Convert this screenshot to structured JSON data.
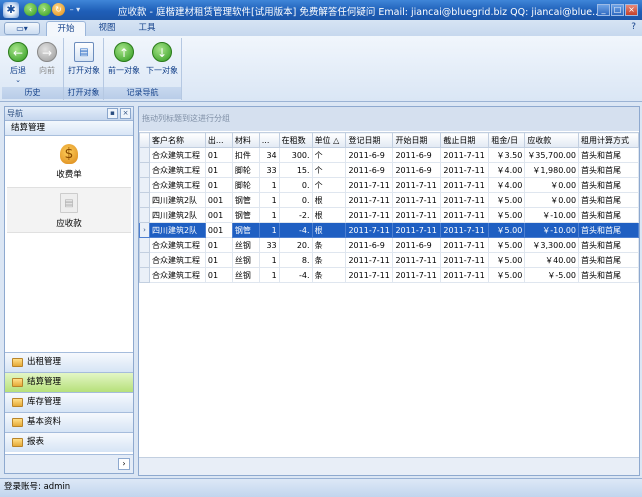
{
  "window": {
    "title": "应收款 - 庭楷建材租赁管理软件[试用版本] 免费解答任何疑问 Email: jiancai@bluegrid.biz QQ: jiancai@blue...",
    "minimize": "_",
    "maximize": "□",
    "close": "×"
  },
  "ribbon": {
    "file_button": "▭▾",
    "tabs": [
      {
        "label": "开始",
        "active": true
      },
      {
        "label": "视图",
        "active": false
      },
      {
        "label": "工具",
        "active": false
      }
    ],
    "help": "?",
    "groups": [
      {
        "label": "历史",
        "buttons": [
          {
            "label": "后退",
            "sub": "⌄",
            "icon": "back-arrow-icon"
          },
          {
            "label": "向前",
            "icon": "forward-arrow-icon",
            "disabled": true
          }
        ]
      },
      {
        "label": "打开对象",
        "buttons": [
          {
            "label": "打开对象",
            "icon": "open-object-icon"
          }
        ]
      },
      {
        "label": "记录导航",
        "buttons": [
          {
            "label": "前一对象",
            "icon": "up-arrow-icon"
          },
          {
            "label": "下一对象",
            "icon": "down-arrow-icon"
          }
        ]
      }
    ]
  },
  "nav": {
    "title": "导航",
    "pin": "▪",
    "close": "×",
    "group_title": "结算管理",
    "items": [
      {
        "label": "收费单",
        "icon": "money-bag-icon",
        "selected": true
      },
      {
        "label": "应收款",
        "icon": "receipt-icon",
        "selected": false
      }
    ],
    "bars": [
      {
        "label": "出租管理",
        "active": false
      },
      {
        "label": "结算管理",
        "active": true
      },
      {
        "label": "库存管理",
        "active": false
      },
      {
        "label": "基本资料",
        "active": false
      },
      {
        "label": "报表",
        "active": false
      }
    ],
    "expand": "›"
  },
  "grid": {
    "group_hint": "拖动列标题到这进行分组",
    "columns": [
      "客户名称",
      "出...",
      "材料",
      "...",
      "在租数",
      "单位 △",
      "登记日期",
      "开始日期",
      "截止日期",
      "租金/日",
      "应收款",
      "租用计算方式"
    ],
    "selected_row": 5,
    "rows": [
      [
        "合众建筑工程",
        "01",
        "扣件",
        "34",
        "300.",
        "个",
        "2011-6-9",
        "2011-6-9",
        "2011-7-11",
        "￥3.50",
        "￥35,700.00",
        "首头和首尾"
      ],
      [
        "合众建筑工程",
        "01",
        "脚轮",
        "33",
        "15.",
        "个",
        "2011-6-9",
        "2011-6-9",
        "2011-7-11",
        "￥4.00",
        "￥1,980.00",
        "首头和首尾"
      ],
      [
        "合众建筑工程",
        "01",
        "脚轮",
        "1",
        "0.",
        "个",
        "2011-7-11",
        "2011-7-11",
        "2011-7-11",
        "￥4.00",
        "￥0.00",
        "首头和首尾"
      ],
      [
        "四川建筑2队",
        "001",
        "钢管",
        "1",
        "0.",
        "根",
        "2011-7-11",
        "2011-7-11",
        "2011-7-11",
        "￥5.00",
        "￥0.00",
        "首头和首尾"
      ],
      [
        "四川建筑2队",
        "001",
        "钢管",
        "1",
        "-2.",
        "根",
        "2011-7-11",
        "2011-7-11",
        "2011-7-11",
        "￥5.00",
        "￥-10.00",
        "首头和首尾"
      ],
      [
        "四川建筑2队",
        "001",
        "钢管",
        "1",
        "-4.",
        "根",
        "2011-7-11",
        "2011-7-11",
        "2011-7-11",
        "￥5.00",
        "￥-10.00",
        "首头和首尾"
      ],
      [
        "合众建筑工程",
        "01",
        "丝钢",
        "33",
        "20.",
        "条",
        "2011-6-9",
        "2011-6-9",
        "2011-7-11",
        "￥5.00",
        "￥3,300.00",
        "首头和首尾"
      ],
      [
        "合众建筑工程",
        "01",
        "丝钢",
        "1",
        "8.",
        "条",
        "2011-7-11",
        "2011-7-11",
        "2011-7-11",
        "￥5.00",
        "￥40.00",
        "首头和首尾"
      ],
      [
        "合众建筑工程",
        "01",
        "丝钢",
        "1",
        "-4.",
        "条",
        "2011-7-11",
        "2011-7-11",
        "2011-7-11",
        "￥5.00",
        "￥-5.00",
        "首头和首尾"
      ]
    ]
  },
  "status": {
    "text": "登录账号: admin"
  },
  "colors": {
    "accent": "#1f5fc2",
    "active_nav": "#b6e07a"
  }
}
